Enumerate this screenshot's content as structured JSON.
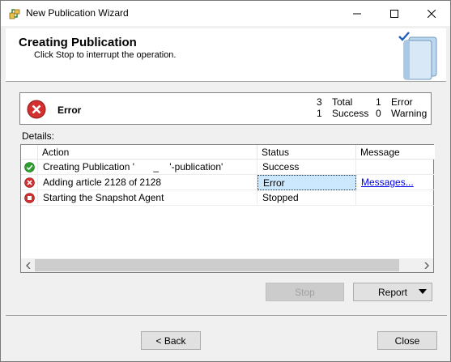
{
  "window": {
    "title": "New Publication Wizard"
  },
  "header": {
    "title": "Creating Publication",
    "subtitle": "Click Stop to interrupt the operation."
  },
  "status": {
    "label": "Error",
    "total_count": "3",
    "total_label": "Total",
    "success_count": "1",
    "success_label": "Success",
    "error_count": "1",
    "error_label": "Error",
    "warning_count": "0",
    "warning_label": "Warning"
  },
  "details": {
    "label": "Details:",
    "columns": [
      "Action",
      "Status",
      "Message"
    ],
    "rows": [
      {
        "icon": "success-icon",
        "action": "Creating Publication '       _    '-publication'",
        "status": "Success",
        "message": ""
      },
      {
        "icon": "error-icon",
        "action": "Adding article 2128 of 2128",
        "status": "Error",
        "message": "Messages..."
      },
      {
        "icon": "stopped-icon",
        "action": "Starting the Snapshot Agent",
        "status": "Stopped",
        "message": ""
      }
    ]
  },
  "buttons": {
    "stop": "Stop",
    "report": "Report",
    "back": "< Back",
    "close": "Close"
  },
  "colors": {
    "error_red": "#d32f2f",
    "success_green": "#2e9e2e",
    "selection": "#cce8ff",
    "link": "#0000ee"
  }
}
